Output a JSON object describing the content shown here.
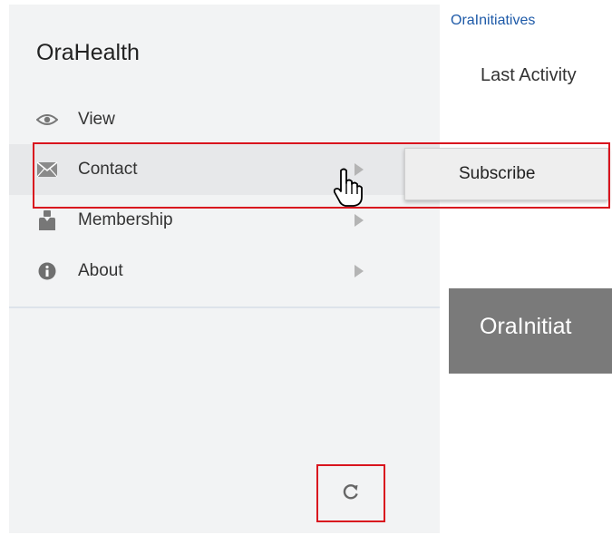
{
  "app": {
    "title": "OraHealth"
  },
  "menu": {
    "items": [
      {
        "label": "View",
        "icon": "eye-icon",
        "has_submenu": false
      },
      {
        "label": "Contact",
        "icon": "envelope-icon",
        "has_submenu": true,
        "active": true
      },
      {
        "label": "Membership",
        "icon": "person-icon",
        "has_submenu": true
      },
      {
        "label": "About",
        "icon": "info-icon",
        "has_submenu": true
      }
    ]
  },
  "submenu": {
    "items": [
      {
        "label": "Subscribe"
      }
    ]
  },
  "content": {
    "breadcrumb": "OraInitiatives",
    "last_activity": "Last Activity",
    "banner_title": "OraInitiat"
  },
  "footer": {
    "refresh_icon": "refresh-icon"
  },
  "colors": {
    "highlight": "#d9141e",
    "link": "#1e5aa8",
    "banner": "#7a7a7a",
    "sidebar_bg": "#f2f3f4"
  }
}
